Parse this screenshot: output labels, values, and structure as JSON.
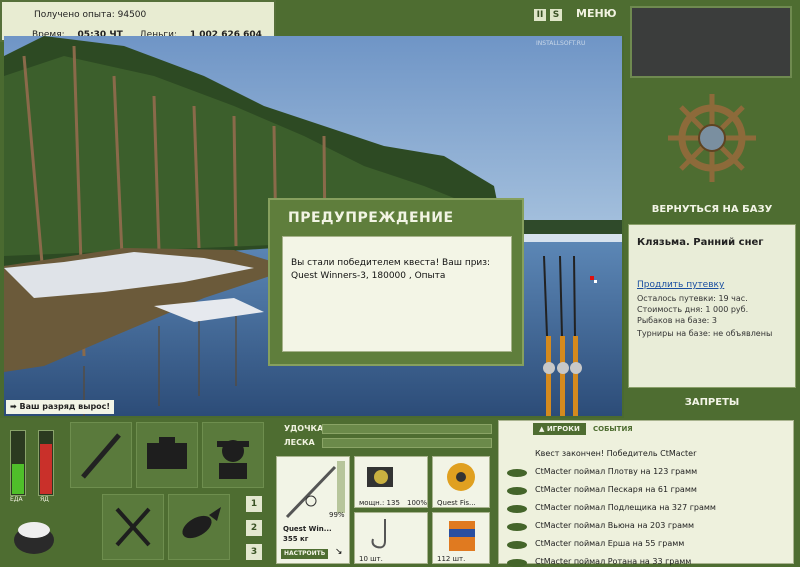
{
  "info": {
    "exp_label": "Получено опыта:",
    "exp_value": "94500",
    "time_label": "Время:",
    "time_value": "05:30 ЧТ",
    "money_label": "Деньги:",
    "money_value": "1 002 626 604 руб."
  },
  "topbar": {
    "pause": "II",
    "s": "S",
    "menu": "МЕНЮ"
  },
  "scene": {
    "watermark": "INSTALLSOFT.RU",
    "level_msg": "Ваш разряд вырос!"
  },
  "dialog": {
    "title": "ПРЕДУПРЕЖДЕНИЕ",
    "text": "Вы стали победителем квеста! Ваш приз: Quest Winners-3, 180000 , Опыта"
  },
  "right": {
    "return_base": "ВЕРНУТЬСЯ НА БАЗУ",
    "location": "Клязьма. Ранний снег",
    "extend": "Продлить путевку",
    "remain": "Осталось путевки: 19 час.",
    "cost": "Стоимость дня: 1 000 руб.",
    "fishers": "Рыбаков на базе: 3",
    "tournaments": "Турниры на базе: не объявлены",
    "bans": "ЗАПРЕТЫ"
  },
  "bottom": {
    "food": "ЕДА",
    "poison": "ЯД",
    "rod_label": "УДОЧКА",
    "line_label": "ЛЕСКА",
    "rod_pct": "99%",
    "rod_name": "Quest Win...",
    "rod_weight": "355 кг",
    "tune": "НАСТРОИТЬ",
    "reel_cap": "мощн.: 135",
    "reel_pct": "100%",
    "line_cap": "Quest Fis...",
    "hook_cap": "10 шт.",
    "bait_cap": "112 шт.",
    "nums": [
      "1",
      "2",
      "3"
    ]
  },
  "events": {
    "tab_players": "ИГРОКИ",
    "tab_events": "СОБЫТИЯ",
    "items": [
      "Квест закончен! Победитель CtMacter",
      "CtMacter поймал Плотву на 123 грамм",
      "CtMacter поймал Пескаря на 61 грамм",
      "CtMacter поймал Подлещика на 327 грамм",
      "CtMacter поймал Вьюна на 203 грамм",
      "CtMacter поймал Ерша на 55 грамм",
      "CtMacter поймал Ротана на 33 грамм"
    ]
  }
}
